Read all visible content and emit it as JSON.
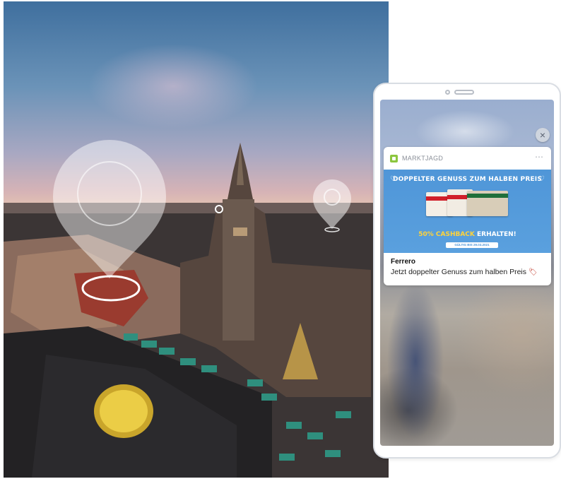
{
  "notification": {
    "app_name": "MARKTJAGD",
    "more_icon": "⋯",
    "close_icon": "×",
    "banner_headline": "DOPPELTER GENUSS ZUM HALBEN PREIS",
    "banner_cashback_highlight": "50% CASHBACK",
    "banner_cashback_rest": " ERHALTEN!",
    "banner_validity": "GÜLTIG BIS 29.03.2021",
    "brand": "Ferrero",
    "message": "Jetzt doppelter Genuss zum halben Preis",
    "message_emoji": "🏷"
  },
  "colors": {
    "accent_green": "#8cc63f",
    "banner_blue": "#5aa0de",
    "cashback_yellow": "#ffd33a"
  },
  "icons": {
    "map_pin_large": "map-pin-icon",
    "map_pin_small": "map-pin-icon",
    "map_dot": "location-dot-icon",
    "heart": "heart-icon"
  }
}
